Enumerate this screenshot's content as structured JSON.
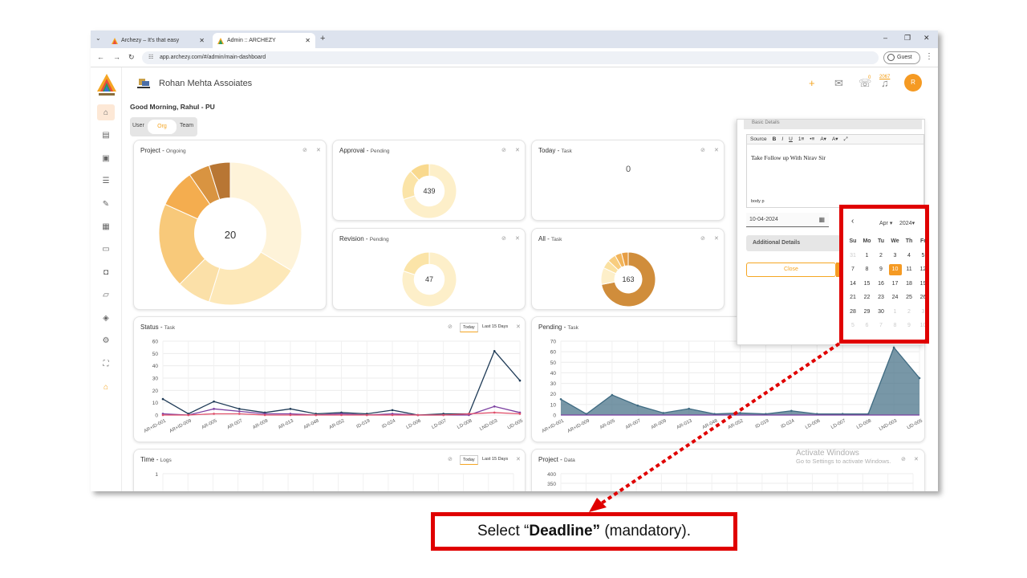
{
  "browser": {
    "tabs": [
      {
        "title": "Archezy – It's that easy"
      },
      {
        "title": "Admin :: ARCHEZY"
      }
    ],
    "url": "app.archezy.com/#/admin/main-dashboard",
    "guest_label": "Guest"
  },
  "header": {
    "company": "Rohan Mehta Assoiates",
    "notif_count": "0",
    "bell_count": "2067",
    "avatar_initial": "R"
  },
  "greeting": "Good Morning, Rahul - PU",
  "view_toggle": {
    "options": [
      "User",
      "Org",
      "Team"
    ],
    "selected": "Org"
  },
  "cards": {
    "project": {
      "title": "Project - ",
      "sub": "Ongoing",
      "center": "20"
    },
    "approval": {
      "title": "Approval - ",
      "sub": "Pending",
      "center": "439"
    },
    "today": {
      "title": "Today - ",
      "sub": "Task",
      "center": "0"
    },
    "revision": {
      "title": "Revision - ",
      "sub": "Pending",
      "center": "47"
    },
    "all": {
      "title": "All - ",
      "sub": "Task",
      "center": "163"
    },
    "status": {
      "title": "Status - ",
      "sub": "Task",
      "range_today": "Today",
      "range_15": "Last 15 Days"
    },
    "pending": {
      "title": "Pending - ",
      "sub": "Task"
    },
    "time": {
      "title": "Time - ",
      "sub": "Logs",
      "range_today": "Today",
      "range_15": "Last 15 Days"
    },
    "projectdata": {
      "title": "Project - ",
      "sub": "Data"
    }
  },
  "chart_data": [
    {
      "type": "line",
      "title": "Status - Task",
      "x": [
        "AR+ID-001",
        "AR+ID-009",
        "AR-005",
        "AR-007",
        "AR-009",
        "AR-013",
        "AR-048",
        "AR-052",
        "ID-019",
        "ID-024",
        "LD-006",
        "LD-007",
        "LD-008",
        "LND-003",
        "UD-005"
      ],
      "ylim": [
        0,
        60
      ],
      "yticks": [
        0,
        10,
        20,
        30,
        40,
        50,
        60
      ],
      "series": [
        {
          "color": "#1f3b57",
          "values": [
            13,
            1,
            11,
            5,
            2,
            5,
            1,
            2,
            1,
            4,
            0,
            1,
            1,
            52,
            28
          ]
        },
        {
          "color": "#7b3fa0",
          "values": [
            1,
            0,
            5,
            3,
            1,
            1,
            0,
            1,
            0,
            1,
            0,
            0,
            0,
            7,
            2
          ]
        },
        {
          "color": "#e0506b",
          "values": [
            0,
            0,
            1,
            1,
            0,
            0,
            0,
            0,
            0,
            0,
            0,
            0,
            1,
            2,
            1
          ]
        }
      ]
    },
    {
      "type": "area",
      "title": "Pending - Task",
      "x": [
        "AR+ID-001",
        "AR+ID-009",
        "AR-005",
        "AR-007",
        "AR-009",
        "AR-013",
        "AR-048",
        "AR-052",
        "ID-019",
        "ID-024",
        "LD-006",
        "LD-007",
        "LD-008",
        "LND-003",
        "UD-005"
      ],
      "ylim": [
        0,
        70
      ],
      "yticks": [
        0,
        10,
        20,
        30,
        40,
        50,
        60,
        70
      ],
      "series": [
        {
          "color": "#3f6b82",
          "values": [
            15,
            1,
            19,
            9,
            2,
            6,
            1,
            2,
            1,
            4,
            1,
            1,
            1,
            64,
            35
          ]
        }
      ]
    },
    {
      "type": "line",
      "title": "Time - Logs",
      "yticks": [
        1.0
      ]
    },
    {
      "type": "line",
      "title": "Project - Data",
      "yticks": [
        350,
        400
      ]
    }
  ],
  "donuts": {
    "project": {
      "values": [
        35,
        22,
        8,
        20,
        9,
        5,
        5
      ],
      "colors": [
        "#fef3d9",
        "#fde8b8",
        "#fbe0a8",
        "#f8c97a",
        "#f4ad4f",
        "#d99441",
        "#b87634"
      ]
    },
    "approval": {
      "values": [
        70,
        18,
        12
      ],
      "colors": [
        "#fdefc9",
        "#fbe4a8",
        "#f9d98e"
      ]
    },
    "revision": {
      "values": [
        80,
        20
      ],
      "colors": [
        "#fdefc9",
        "#fbe4a8"
      ]
    },
    "all": {
      "values": [
        72,
        10,
        5,
        5,
        4,
        4
      ],
      "colors": [
        "#d08d3b",
        "#fdefc9",
        "#fbe1a1",
        "#f8cd7f",
        "#f2b45a",
        "#e79e45"
      ]
    }
  },
  "panel": {
    "section": "Basic Details",
    "toolbar": [
      "Source",
      "B",
      "I",
      "U",
      "1≡",
      "•≡",
      "A▾",
      "A▾",
      "⤢"
    ],
    "editor_text": "Take Follow up With Nirav Sir",
    "editor_footer": "body  p",
    "deadline_value": "10-04-2024",
    "additional": "Additional Details",
    "close_label": "Close"
  },
  "calendar": {
    "month": "Apr",
    "year": "2024",
    "weekdays": [
      "Su",
      "Mo",
      "Tu",
      "We",
      "Th",
      "Fr"
    ],
    "selected": "10",
    "weeks": [
      [
        "31",
        "1",
        "2",
        "3",
        "4",
        "5"
      ],
      [
        "7",
        "8",
        "9",
        "10",
        "11",
        "12"
      ],
      [
        "14",
        "15",
        "16",
        "17",
        "18",
        "19"
      ],
      [
        "21",
        "22",
        "23",
        "24",
        "25",
        "26"
      ],
      [
        "28",
        "29",
        "30",
        "1",
        "2",
        "3"
      ],
      [
        "5",
        "6",
        "7",
        "8",
        "9",
        "10"
      ]
    ]
  },
  "callout": {
    "pre": "Select “",
    "bold": "Deadline”",
    "post": " (mandatory)."
  },
  "watermark": {
    "line1": "Activate Windows",
    "line2": "Go to Settings to activate Windows."
  }
}
